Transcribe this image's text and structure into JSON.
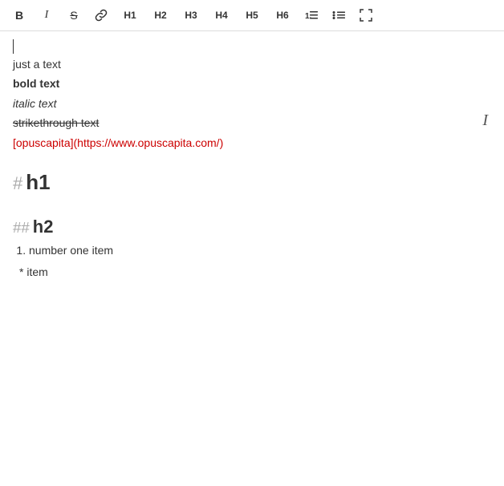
{
  "toolbar": {
    "buttons": [
      {
        "id": "bold",
        "label": "B",
        "style": "bold",
        "title": "Bold"
      },
      {
        "id": "italic",
        "label": "I",
        "style": "italic",
        "title": "Italic"
      },
      {
        "id": "strikethrough",
        "label": "S",
        "style": "strikethrough",
        "title": "Strikethrough"
      },
      {
        "id": "link",
        "label": "🔗",
        "style": "icon",
        "title": "Link"
      },
      {
        "id": "h1",
        "label": "H1",
        "style": "heading",
        "title": "Heading 1"
      },
      {
        "id": "h2",
        "label": "H2",
        "style": "heading",
        "title": "Heading 2"
      },
      {
        "id": "h3",
        "label": "H3",
        "style": "heading",
        "title": "Heading 3"
      },
      {
        "id": "h4",
        "label": "H4",
        "style": "heading",
        "title": "Heading 4"
      },
      {
        "id": "h5",
        "label": "H5",
        "style": "heading",
        "title": "Heading 5"
      },
      {
        "id": "h6",
        "label": "H6",
        "style": "heading",
        "title": "Heading 6"
      },
      {
        "id": "ordered-list",
        "label": "ol",
        "style": "list",
        "title": "Ordered List"
      },
      {
        "id": "unordered-list",
        "label": "ul",
        "style": "list",
        "title": "Unordered List"
      },
      {
        "id": "fullscreen",
        "label": "⤢",
        "style": "icon",
        "title": "Fullscreen"
      }
    ]
  },
  "editor": {
    "cursor_line": "",
    "lines": [
      {
        "type": "text",
        "content": "just a text"
      },
      {
        "type": "bold",
        "content": "bold text"
      },
      {
        "type": "italic",
        "content": "italic text"
      },
      {
        "type": "strikethrough",
        "content": "strikethrough text"
      },
      {
        "type": "link",
        "content": "[opuscapita](https://www.opuscapita.com/)"
      }
    ],
    "h1_prefix": "#",
    "h1_text": "h1",
    "h2_prefix": "##",
    "h2_text": "h2",
    "ordered_item": "number one item",
    "bullet_item": "item",
    "cursor_icon": "𝐼"
  }
}
